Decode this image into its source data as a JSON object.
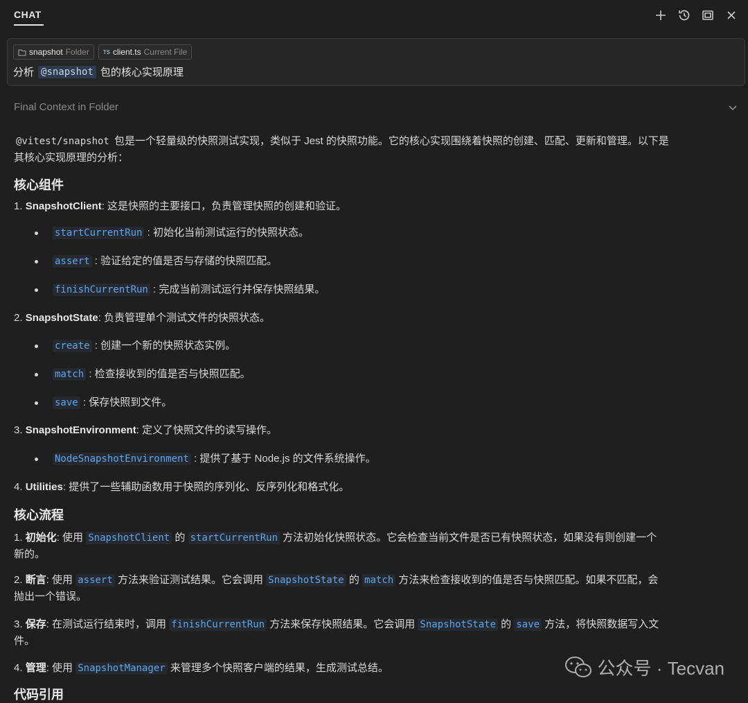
{
  "header": {
    "tab": "CHAT"
  },
  "chips": [
    {
      "name": "snapshot",
      "kind": "Folder",
      "icon": "folder-icon"
    },
    {
      "name": "client.ts",
      "kind": "Current File",
      "icon": "ts-file-icon",
      "icon_text": "TS"
    }
  ],
  "prompt": {
    "before": "分析",
    "mention": "@snapshot",
    "after": "包的核心实现原理"
  },
  "context": {
    "label": "Final Context in Folder"
  },
  "intro": {
    "code": "@vitest/snapshot",
    "line1": " 包是一个轻量级的快照测试实现，类似于 Jest 的快照功能。它的核心实现围绕着快照的创建、匹配、更新和管理。以下是",
    "line2": "其核心实现原理的分析："
  },
  "sections": {
    "components_title": "核心组件",
    "flow_title": "核心流程",
    "refs_title": "代码引用"
  },
  "components": [
    {
      "num": "1.",
      "name": "SnapshotClient",
      "desc": ": 这是快照的主要接口，负责管理快照的创建和验证。"
    },
    {
      "num": "2.",
      "name": "SnapshotState",
      "desc": ": 负责管理单个测试文件的快照状态。"
    },
    {
      "num": "3.",
      "name": "SnapshotEnvironment",
      "desc": ": 定义了快照文件的读写操作。"
    },
    {
      "num": "4.",
      "name": "Utilities",
      "desc": ": 提供了一些辅助函数用于快照的序列化、反序列化和格式化。"
    }
  ],
  "bullets": [
    {
      "code": "startCurrentRun",
      "desc": " : 初始化当前测试运行的快照状态。"
    },
    {
      "code": "assert",
      "desc": " : 验证给定的值是否与存储的快照匹配。"
    },
    {
      "code": "finishCurrentRun",
      "desc": " : 完成当前测试运行并保存快照结果。"
    },
    {
      "code": "create",
      "desc": " : 创建一个新的快照状态实例。"
    },
    {
      "code": "match",
      "desc": " : 检查接收到的值是否与快照匹配。"
    },
    {
      "code": "save",
      "desc": " : 保存快照到文件。"
    },
    {
      "code": "NodeSnapshotEnvironment",
      "desc": " : 提供了基于 Node.js 的文件系统操作。"
    }
  ],
  "flow": [
    {
      "num": "1.",
      "title": "初始化",
      "t1": ": 使用 ",
      "c1": "SnapshotClient",
      "t2": " 的 ",
      "c2": "startCurrentRun",
      "t3": " 方法初始化快照状态。它会检查当前文件是否已有快照状态，如果没有则创建一个",
      "line2": "新的。"
    },
    {
      "num": "2.",
      "title": "断言",
      "t1": ": 使用 ",
      "c1": "assert",
      "t2": " 方法来验证测试结果。它会调用 ",
      "c2": "SnapshotState",
      "t3": " 的 ",
      "c3": "match",
      "t4": " 方法来检查接收到的值是否与快照匹配。如果不匹配，会",
      "line2": "抛出一个错误。"
    },
    {
      "num": "3.",
      "title": "保存",
      "t1": ": 在测试运行结束时，调用 ",
      "c1": "finishCurrentRun",
      "t2": " 方法来保存快照结果。它会调用 ",
      "c2": "SnapshotState",
      "t3": " 的 ",
      "c3": "save",
      "t4": " 方法，将快照数据写入文",
      "line2": "件。"
    },
    {
      "num": "4.",
      "title": "管理",
      "t1": ": 使用 ",
      "c1": "SnapshotManager",
      "t2": " 来管理多个快照客户端的结果，生成测试总结。"
    }
  ],
  "watermark": {
    "text": "公众号 · Tecvan",
    "icon": "wechat-icon"
  },
  "colors": {
    "background": "#1f1f1f",
    "code_blue": "#5aa7f0",
    "text": "#d8d8d8"
  }
}
